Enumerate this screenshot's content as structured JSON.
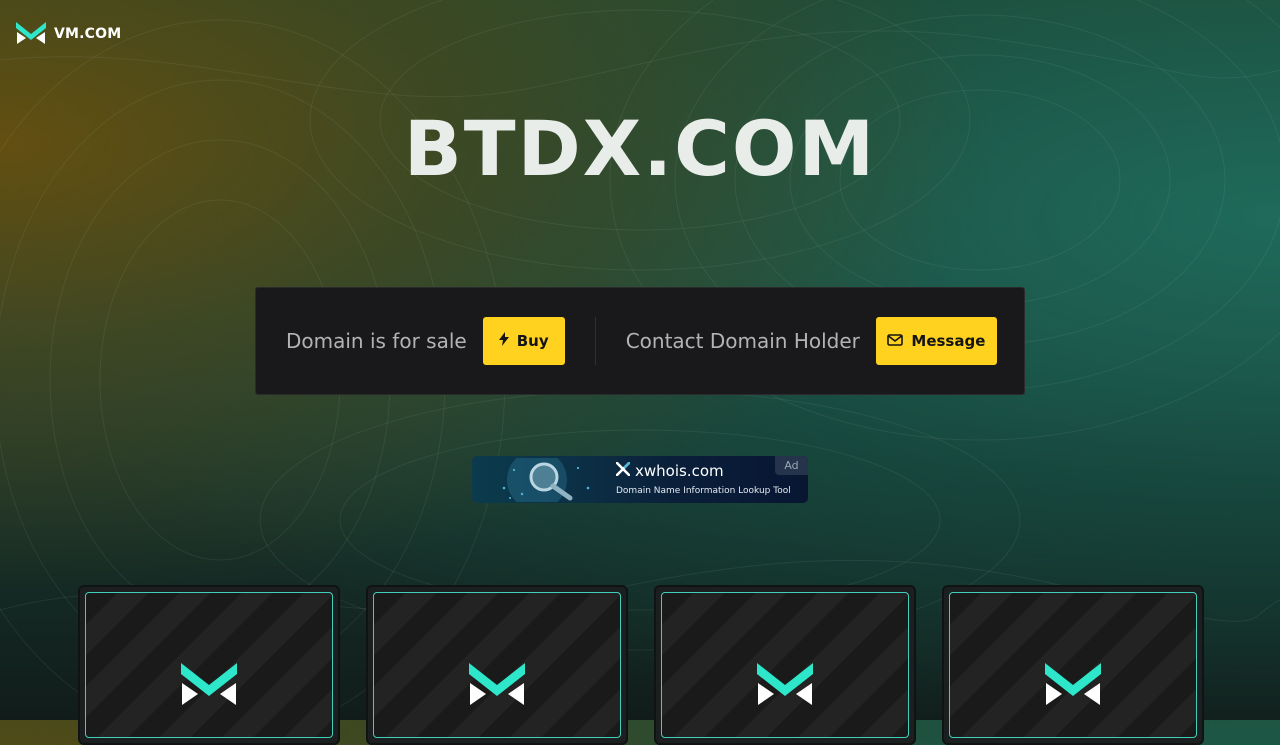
{
  "brand": {
    "name": "VM.COM",
    "logo_icon": "vm-logo-icon"
  },
  "domain": {
    "name": "BTDX.COM"
  },
  "sale_panel": {
    "for_sale_text": "Domain is for sale",
    "buy_label": "Buy",
    "buy_icon": "lightning-icon",
    "contact_text": "Contact Domain Holder",
    "message_label": "Message",
    "message_icon": "envelope-icon"
  },
  "ad": {
    "badge": "Ad",
    "domain": "xwhois.com",
    "tagline": "Domain Name Information Lookup Tool",
    "icon": "magnifier-globe-icon"
  },
  "cards": [
    {
      "icon": "vm-logo-icon"
    },
    {
      "icon": "vm-logo-icon"
    },
    {
      "icon": "vm-logo-icon"
    },
    {
      "icon": "vm-logo-icon"
    }
  ],
  "colors": {
    "accent_yellow": "#ffd21f",
    "teal": "#2ee6c9",
    "panel": "#19191b"
  }
}
